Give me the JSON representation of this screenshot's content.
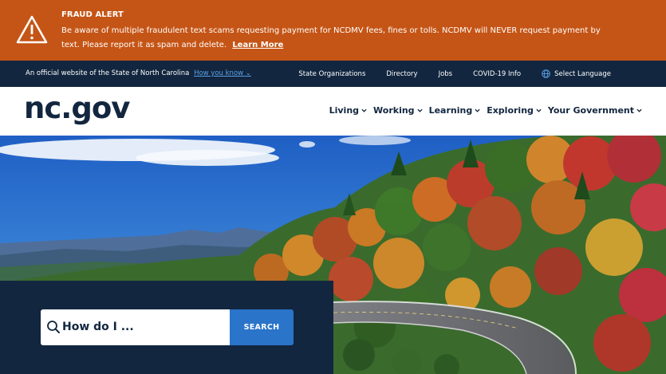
{
  "alert": {
    "title": "FRAUD ALERT",
    "message": "Be aware of multiple fraudulent text scams requesting payment for NCDMV fees, fines or tolls. NCDMV will NEVER request payment by text. Please report it as spam and delete.",
    "link": "Learn More",
    "icon": "warning-triangle-icon",
    "color": "#c55516"
  },
  "utility": {
    "official_text": "An official website of the State of North Carolina",
    "how_link": "How you know",
    "nav": [
      "State Organizations",
      "Directory",
      "Jobs",
      "COVID-19 Info"
    ],
    "language": "Select Language",
    "color": "#12263f"
  },
  "header": {
    "logo": "nc.gov",
    "nav": [
      "Living",
      "Working",
      "Learning",
      "Exploring",
      "Your Government"
    ]
  },
  "search": {
    "placeholder": "How do I ...",
    "button": "SEARCH",
    "button_color": "#2a74c9"
  }
}
